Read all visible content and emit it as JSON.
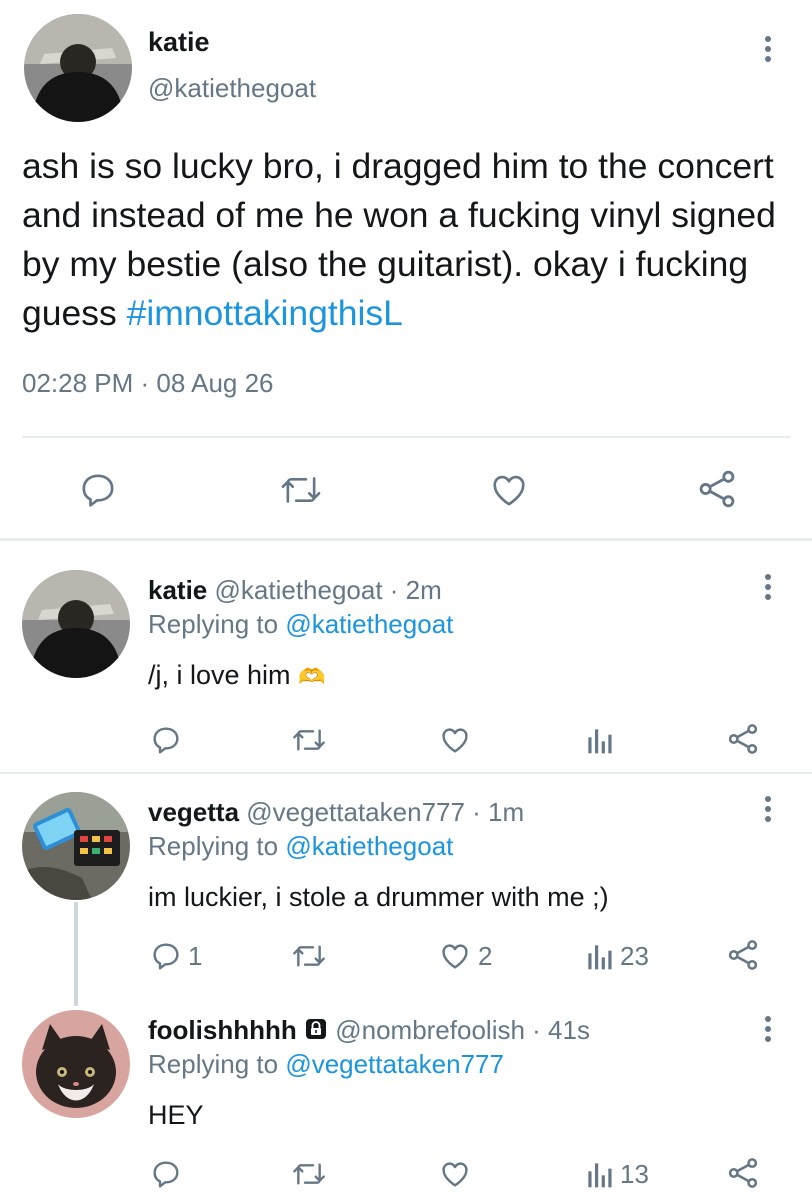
{
  "main_tweet": {
    "display_name": "katie",
    "handle": "@katiethegoat",
    "text": "ash is so lucky bro, i dragged him to the concert and instead of me he won a fucking vinyl signed by my bestie (also the guitarist). okay i fucking guess",
    "hashtag": "#imnottakingthisL",
    "timestamp": "02:28 PM · 08 Aug 26",
    "actions": [
      "reply-icon",
      "retweet-icon",
      "like-icon",
      "share-icon"
    ]
  },
  "replies": [
    {
      "display_name": "katie",
      "handle_time": "@katiethegoat · 2m",
      "replying_prefix": "Replying to",
      "replying_to": "@katiethegoat",
      "text": "/j, i love him",
      "emoji": "🫶",
      "reply_count": "",
      "like_count": "",
      "view_count": ""
    },
    {
      "display_name": "vegetta",
      "handle_time": "@vegettataken777 · 1m",
      "replying_prefix": "Replying to",
      "replying_to": "@katiethegoat",
      "text": "im luckier, i stole a drummer with me ;)",
      "reply_count": "1",
      "like_count": "2",
      "view_count": "23"
    },
    {
      "display_name": "foolishhhhh",
      "handle_time": "@nombrefoolish · 41s",
      "replying_prefix": "Replying to",
      "replying_to": "@vegettataken777",
      "text": "HEY",
      "reply_count": "",
      "like_count": "",
      "view_count": "13",
      "protected": true
    }
  ],
  "colors": {
    "text": "#14171a",
    "muted": "#657786",
    "link": "#1b95e0",
    "divider": "#e6ecf0",
    "background": "#ffffff"
  }
}
